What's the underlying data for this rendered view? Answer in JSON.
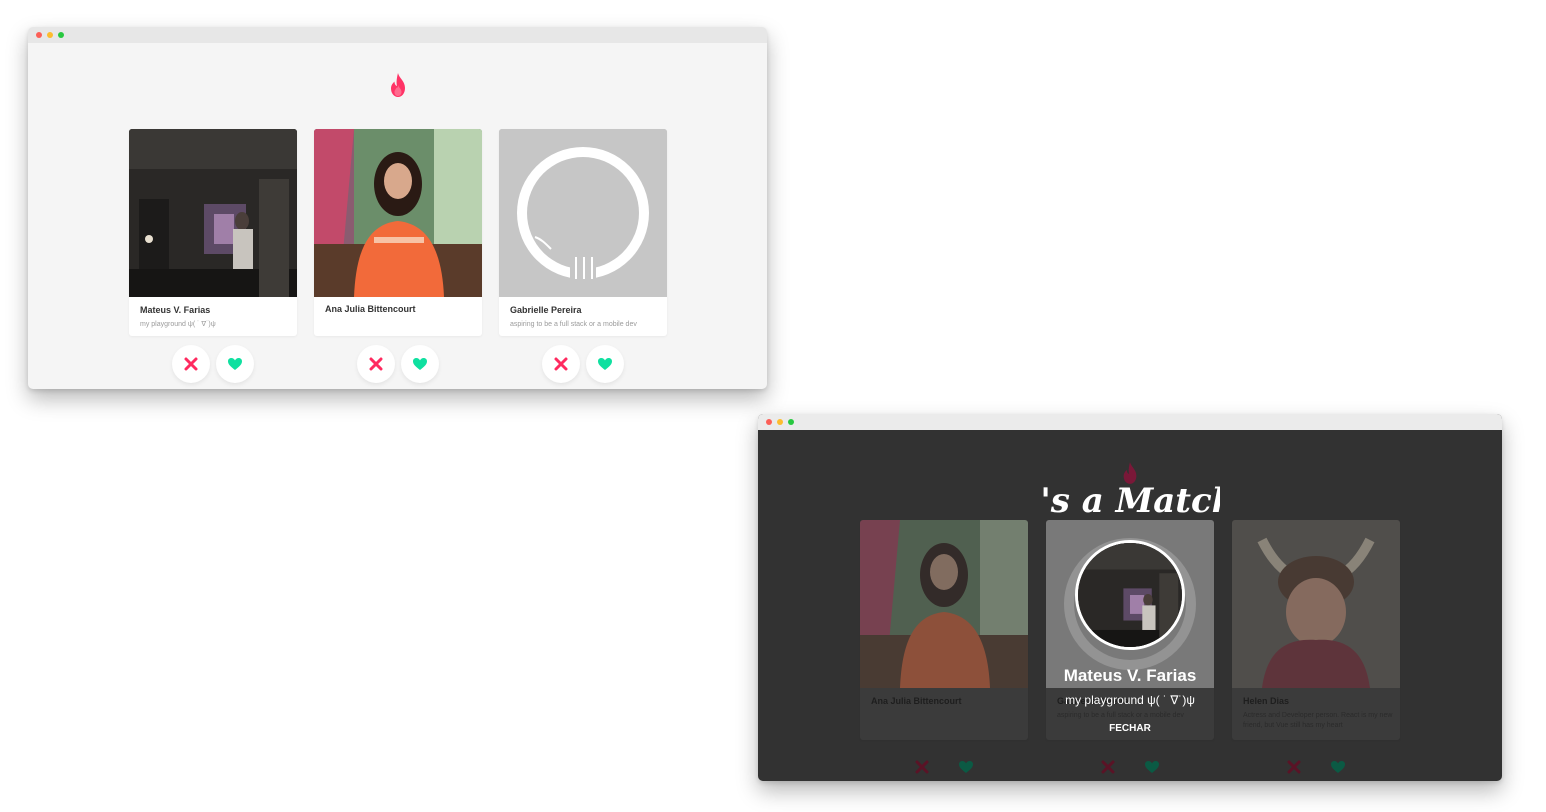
{
  "brand": {
    "icon": "flame-icon",
    "color": "#ff3366"
  },
  "colors": {
    "dislike": "#ff2a5f",
    "like": "#0fe0a0",
    "overlay": "#323232"
  },
  "screen_list": {
    "cards": [
      {
        "name": "Mateus V. Farias",
        "bio": "my playground ψ( ˙ ∇˙)ψ",
        "avatar": "photo-dark-room"
      },
      {
        "name": "Ana Julia Bittencourt",
        "bio": "",
        "avatar": "photo-orange-shirt"
      },
      {
        "name": "Gabrielle Pereira",
        "bio": "aspiring to be a full stack or a mobile dev",
        "avatar": "github-octocat-placeholder"
      }
    ],
    "dislike_icon": "close-x-icon",
    "like_icon": "heart-icon"
  },
  "screen_match": {
    "title": "It's a Match!",
    "match": {
      "name": "Mateus V. Farias",
      "bio": "my playground ψ( ˙ ∇˙)ψ"
    },
    "close_label": "FECHAR",
    "cards": [
      {
        "name": "Ana Julia Bittencourt",
        "bio": ""
      },
      {
        "name": "Gabrielle Pereira",
        "bio": "aspiring to be a full stack or a mobile dev"
      },
      {
        "name": "Helen Dias",
        "bio": "Actress and Developer person. React is my new friend, but Vue still has my heart"
      }
    ]
  }
}
